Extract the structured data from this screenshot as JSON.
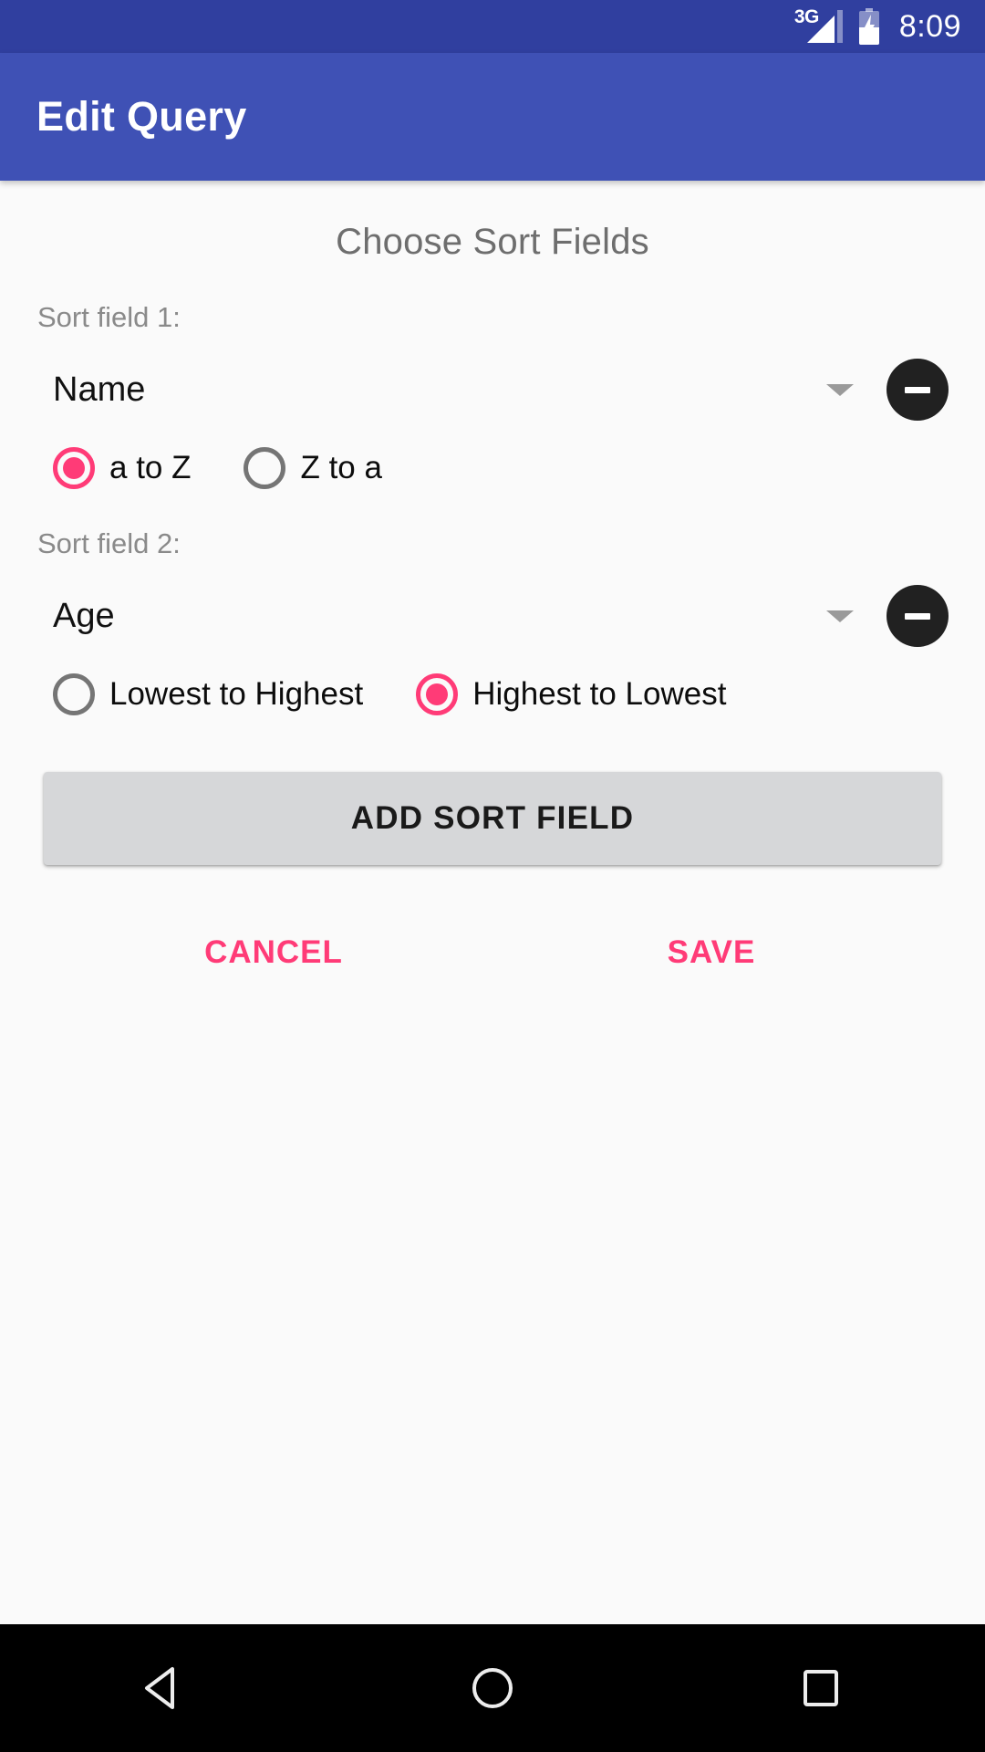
{
  "status_bar": {
    "network": "3G",
    "time": "8:09",
    "signal_icon": "signal-bars-icon",
    "battery_icon": "battery-charging-icon"
  },
  "app_bar": {
    "title": "Edit Query"
  },
  "main": {
    "section_title": "Choose Sort Fields",
    "sort_fields": [
      {
        "label": "Sort field 1:",
        "value": "Name",
        "remove_icon": "minus-circle-icon",
        "dropdown_icon": "chevron-down-icon",
        "options": [
          {
            "label": "a to Z",
            "selected": true
          },
          {
            "label": "Z to a",
            "selected": false
          }
        ]
      },
      {
        "label": "Sort field 2:",
        "value": "Age",
        "remove_icon": "minus-circle-icon",
        "dropdown_icon": "chevron-down-icon",
        "options": [
          {
            "label": "Lowest to Highest",
            "selected": false
          },
          {
            "label": "Highest to Lowest",
            "selected": true
          }
        ]
      }
    ],
    "add_button": "ADD SORT FIELD",
    "cancel_button": "CANCEL",
    "save_button": "SAVE"
  },
  "nav_bar": {
    "back": "back-triangle-icon",
    "home": "home-circle-icon",
    "recents": "recents-square-icon"
  },
  "colors": {
    "status_bar": "#303F9F",
    "app_bar": "#3F51B5",
    "accent_pink": "#FF3B77",
    "background": "#FAFAFA",
    "button_grey": "#D6D7D9"
  }
}
